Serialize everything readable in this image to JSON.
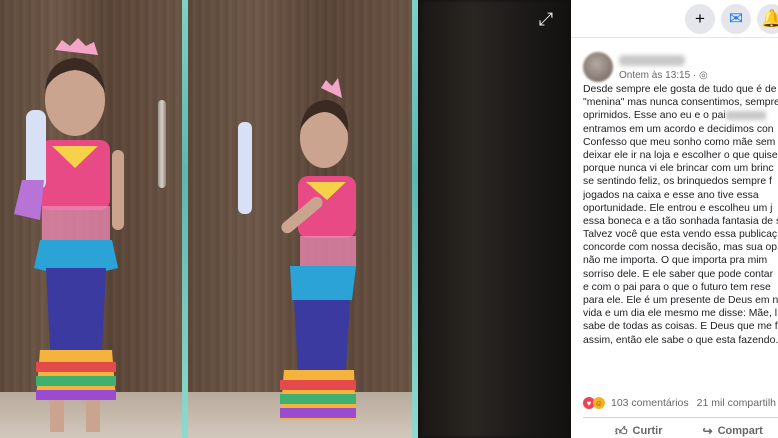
{
  "viewer": {
    "expand_icon": "expand-icon"
  },
  "topbar": {
    "buttons": [
      {
        "name": "new-button",
        "glyph": "+"
      },
      {
        "name": "messenger-button",
        "glyph": "✉"
      },
      {
        "name": "notifications-button",
        "glyph": "🔔"
      }
    ]
  },
  "post": {
    "timestamp": "Ontem às 13:15 · ",
    "lines": [
      "Desde sempre ele gosta de tudo que é de",
      "\"menina\" mas nunca consentimos, sempre",
      "oprimidos. Esse ano eu e o pai",
      "entramos em um acordo e decidimos con",
      "Confesso que meu sonho como mãe sem",
      "deixar ele ir na loja e escolher o que quise",
      "porque nunca vi ele brincar com um brinc",
      "se sentindo feliz, os brinquedos sempre f",
      "jogados na caixa e esse ano tive essa",
      "oportunidade. Ele entrou e escolheu um j",
      "essa boneca e a tão sonhada fantasia de s",
      "Talvez você que esta vendo essa publicaç",
      "concorde com nossa decisão, mas sua op",
      "não me importa. O que importa pra mim",
      "sorriso dele. E ele saber que pode contar",
      "e com o pai para o que o futuro tem rese",
      "para ele. Ele é um presente de Deus em n",
      "vida e um dia ele mesmo me disse: Mãe, l",
      "sabe de todas as coisas. E Deus que me fe",
      "assim, então ele sabe o que esta fazendo."
    ],
    "comments": "103 comentários",
    "shares": "21 mil compartilh"
  },
  "actions": {
    "comment": "Curtir",
    "share": "Compart"
  },
  "colors": {
    "like_blue": "#1877f2",
    "love_red": "#f33e58"
  }
}
